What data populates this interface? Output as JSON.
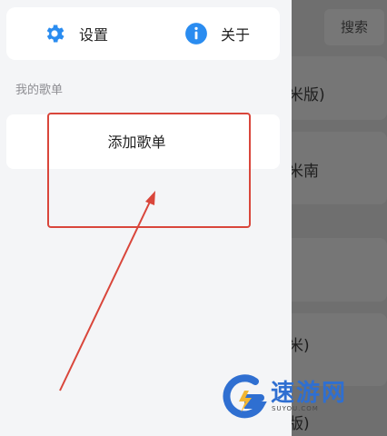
{
  "background": {
    "search_label": "搜索",
    "list_texts": [
      "基米版)",
      "基米南",
      "基米)",
      "八版)"
    ]
  },
  "drawer": {
    "menu": {
      "settings_label": "设置",
      "settings_icon": "gear-icon",
      "about_label": "关于",
      "about_icon": "info-icon"
    },
    "section_title": "我的歌单",
    "add_playlist_label": "添加歌单"
  },
  "watermark": {
    "text": "速游网",
    "sub": "SUYOU.COM"
  },
  "colors": {
    "accent": "#2a8cf0",
    "annotation_red": "#d9463b",
    "dim_overlay": "#6f6f6f"
  }
}
